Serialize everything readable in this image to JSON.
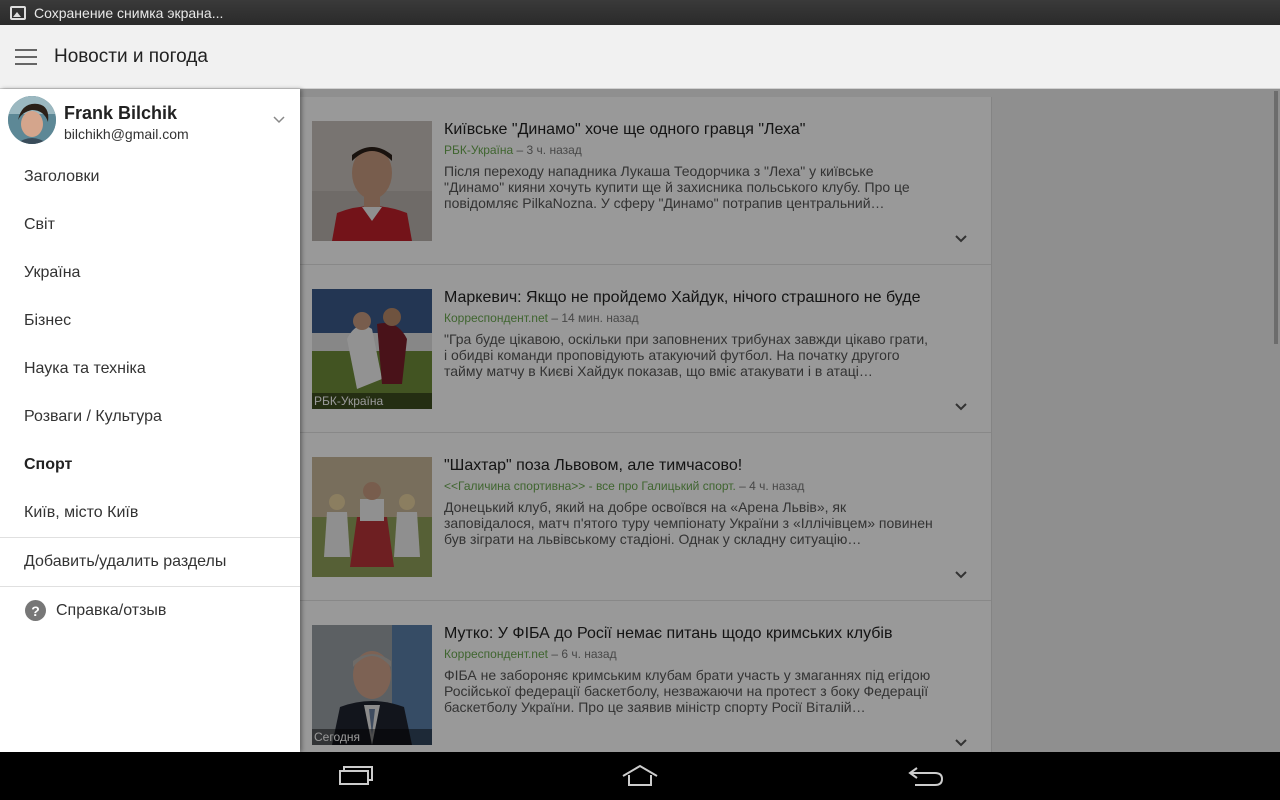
{
  "status_bar": {
    "notification_text": "Сохранение снимка экрана..."
  },
  "app_bar": {
    "title": "Новости и погода"
  },
  "drawer": {
    "account": {
      "name": "Frank Bilchik",
      "email": "bilchikh@gmail.com"
    },
    "items": [
      {
        "label": "Заголовки"
      },
      {
        "label": "Світ"
      },
      {
        "label": "Україна"
      },
      {
        "label": "Бізнес"
      },
      {
        "label": "Наука та техніка"
      },
      {
        "label": "Розваги / Культура"
      },
      {
        "label": "Спорт",
        "active": true
      },
      {
        "label": "Київ, місто Київ"
      }
    ],
    "manage_sections": "Добавить/удалить разделы",
    "help": "Справка/отзыв"
  },
  "articles": [
    {
      "title": "Київське \"Динамо\" хоче ще одного гравця \"Леха\"",
      "source": "РБК-Україна",
      "time": "– 3 ч. назад",
      "snippet": "Після переходу нападника Лукаша Теодорчика з \"Леха\" у київське \"Динамо\" кияни хочуть купити ще й захисника польського клубу. Про це повідомляє PilkaNozna. У сферу \"Динамо\" потрапив центральний…",
      "thumb_label": ""
    },
    {
      "title": "Маркевич: Якщо не пройдемо Хайдук, нічого страшного не буде",
      "source": "Корреспондент.net",
      "time": "– 14 мин. назад",
      "snippet": "\"Гра буде цікавою, оскільки при заповнених трибунах завжди цікаво грати, і обидві команди проповідують атакуючий футбол. На початку другого тайму матчу в Києві Хайдук показав, що вміє атакувати і в атаці…",
      "thumb_label": "РБК-Україна"
    },
    {
      "title": "\"Шахтар\" поза Львовом, але тимчасово!",
      "source": "<<Галичина спортивна>> - все про Галицький спорт.",
      "time": "– 4 ч. назад",
      "snippet": "Донецький клуб, який на добре освоївся на «Арена Львів», як заповідалося, матч п'ятого туру чемпіонату України з «Іллічівцем» повинен був зіграти на львівському стадіоні. Однак у складну ситуацію…",
      "thumb_label": ""
    },
    {
      "title": "Мутко: У ФІБА до Росії немає питань щодо кримських клубів",
      "source": "Корреспондент.net",
      "time": "– 6 ч. назад",
      "snippet": "ФІБА не забороняє кримським клубам брати участь у змаганнях під егідою Російської федерації баскетболу, незважаючи на протест з боку Федерації баскетболу України. Про це заявив міністр спорту Росії Віталій…",
      "thumb_label": "Сегодня"
    }
  ],
  "icons": {
    "status": "image-icon",
    "menu": "hamburger-menu-icon",
    "account_expand": "chevron-down-icon",
    "article_expand": "chevron-down-icon",
    "help": "help-circle-icon",
    "nav": [
      "recent-apps-icon",
      "home-icon",
      "back-icon"
    ]
  },
  "colors": {
    "source_green": "#6aa84f",
    "app_bar_bg": "#f1f1f1",
    "scrim": "rgba(0,0,0,0.4)"
  }
}
